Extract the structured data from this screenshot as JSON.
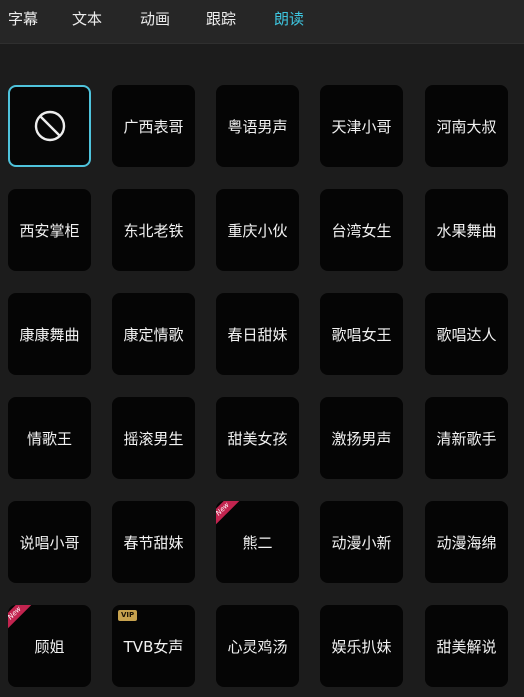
{
  "tabs": [
    {
      "label": "字幕",
      "active": false
    },
    {
      "label": "文本",
      "active": false
    },
    {
      "label": "动画",
      "active": false
    },
    {
      "label": "跟踪",
      "active": false
    },
    {
      "label": "朗读",
      "active": true
    }
  ],
  "accent_color": "#3ec6e0",
  "voices": [
    {
      "label": "",
      "icon": "none-icon",
      "selected": true
    },
    {
      "label": "广西表哥"
    },
    {
      "label": "粤语男声"
    },
    {
      "label": "天津小哥"
    },
    {
      "label": "河南大叔"
    },
    {
      "label": "西安掌柜"
    },
    {
      "label": "东北老铁"
    },
    {
      "label": "重庆小伙"
    },
    {
      "label": "台湾女生"
    },
    {
      "label": "水果舞曲"
    },
    {
      "label": "康康舞曲"
    },
    {
      "label": "康定情歌"
    },
    {
      "label": "春日甜妹"
    },
    {
      "label": "歌唱女王"
    },
    {
      "label": "歌唱达人"
    },
    {
      "label": "情歌王"
    },
    {
      "label": "摇滚男生"
    },
    {
      "label": "甜美女孩"
    },
    {
      "label": "激扬男声"
    },
    {
      "label": "清新歌手"
    },
    {
      "label": "说唱小哥"
    },
    {
      "label": "春节甜妹"
    },
    {
      "label": "熊二",
      "badge": "new",
      "badge_text": "New"
    },
    {
      "label": "动漫小新"
    },
    {
      "label": "动漫海绵"
    },
    {
      "label": "顾姐",
      "badge": "new",
      "badge_text": "New"
    },
    {
      "label": "TVB女声",
      "badge": "vip",
      "badge_text": "VIP"
    },
    {
      "label": "心灵鸡汤"
    },
    {
      "label": "娱乐扒妹"
    },
    {
      "label": "甜美解说"
    }
  ]
}
